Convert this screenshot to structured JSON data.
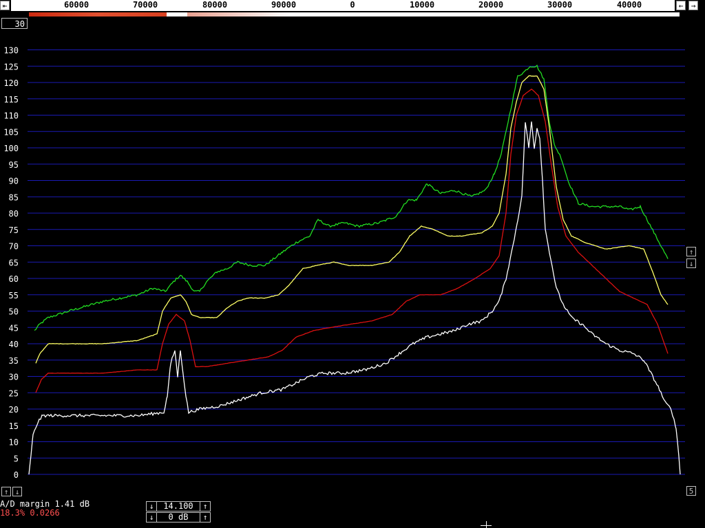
{
  "freq_bar": {
    "scroll_left_icon": "arrow-left-icon",
    "scroll_right_icon": "arrow-right-icon",
    "labels": [
      "60000",
      "70000",
      "80000",
      "90000",
      "0",
      "10000",
      "20000",
      "30000",
      "40000"
    ]
  },
  "zoom": {
    "value": "30"
  },
  "y_axis": {
    "ticks": [
      "130",
      "125",
      "120",
      "115",
      "110",
      "105",
      "100",
      "95",
      "90",
      "85",
      "80",
      "75",
      "70",
      "65",
      "60",
      "55",
      "50",
      "45",
      "40",
      "35",
      "30",
      "25",
      "20",
      "15",
      "10",
      "5",
      "0"
    ]
  },
  "spectrum": {
    "grid_color": "#1a1ab4",
    "trace_colors": {
      "green": "#22dd22",
      "yellow": "#ffff66",
      "red": "#dd1111",
      "white": "#ffffff"
    }
  },
  "buttons": {
    "up_icon": "arrow-up-icon",
    "down_icon": "arrow-down-icon",
    "side_up_icon": "arrow-up-icon",
    "side_down_icon": "arrow-down-icon",
    "right_box_label": "5"
  },
  "status": {
    "ad_margin": "A/D margin 1.41 dB",
    "percent_line": "18.3% 0.0266"
  },
  "controls": {
    "gain_value": "14.100",
    "db_value": "0 dB"
  }
}
